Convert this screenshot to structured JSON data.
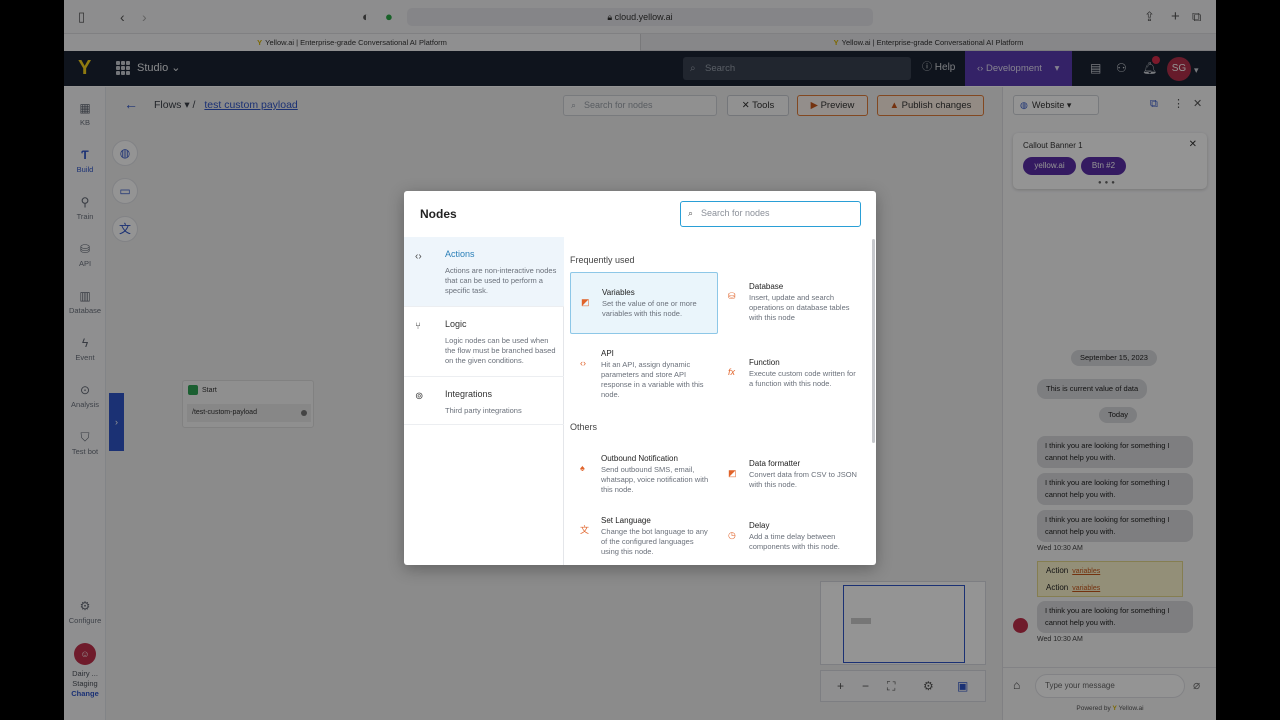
{
  "browser": {
    "url": "cloud.yellow.ai",
    "tabs": [
      {
        "title": "Yellow.ai | Enterprise-grade Conversational AI Platform"
      },
      {
        "title": "Yellow.ai | Enterprise-grade Conversational AI Platform"
      }
    ]
  },
  "header": {
    "app_name": "Studio",
    "search_placeholder": "Search",
    "help_label": "Help",
    "environment": "Development",
    "avatar_initials": "SG"
  },
  "rail": {
    "items": [
      {
        "label": "KB",
        "icon": "kb-icon"
      },
      {
        "label": "Build",
        "icon": "build-icon"
      },
      {
        "label": "Train",
        "icon": "train-icon"
      },
      {
        "label": "API",
        "icon": "api-icon"
      },
      {
        "label": "Database",
        "icon": "database-icon"
      },
      {
        "label": "Event",
        "icon": "event-icon"
      },
      {
        "label": "Analysis",
        "icon": "analysis-icon"
      },
      {
        "label": "Test bot",
        "icon": "test-bot-icon"
      }
    ],
    "configure_label": "Configure",
    "workspace_line1": "Dairy ...",
    "workspace_line2": "Staging",
    "change_label": "Change"
  },
  "canvas": {
    "breadcrumb_root": "Flows",
    "breadcrumb_current": "test custom payload",
    "search_placeholder": "Search for nodes",
    "tools_label": "Tools",
    "preview_label": "Preview",
    "publish_label": "Publish changes",
    "start_node": {
      "title": "Start",
      "path": "/test-custom-payload"
    }
  },
  "modal": {
    "title": "Nodes",
    "search_placeholder": "Search for nodes",
    "categories": [
      {
        "name": "Actions",
        "desc": "Actions are non-interactive nodes that can be used to perform a specific task.",
        "icon": "code-icon"
      },
      {
        "name": "Logic",
        "desc": "Logic nodes can be used when the flow must be branched based on the given conditions.",
        "icon": "branch-icon"
      },
      {
        "name": "Integrations",
        "desc": "Third party integrations",
        "icon": "link-icon"
      }
    ],
    "sections": {
      "frequent": "Frequently used",
      "others": "Others"
    },
    "nodes": [
      {
        "name": "Variables",
        "desc": "Set the value of one or more variables with this node.",
        "icon": "variables-icon"
      },
      {
        "name": "Database",
        "desc": "Insert, update and search operations on database tables with this node",
        "icon": "database-icon"
      },
      {
        "name": "API",
        "desc": "Hit an API, assign dynamic parameters and store API response in a variable with this node.",
        "icon": "api-icon"
      },
      {
        "name": "Function",
        "desc": "Execute custom code written for a function with this node.",
        "icon": "function-icon"
      },
      {
        "name": "Outbound Notification",
        "desc": "Send outbound SMS, email, whatsapp, voice notification with this node.",
        "icon": "bell-icon"
      },
      {
        "name": "Data formatter",
        "desc": "Convert data from CSV to JSON with this node.",
        "icon": "formatter-icon"
      },
      {
        "name": "Set Language",
        "desc": "Change the bot language to any of the configured languages using this node.",
        "icon": "translate-icon"
      },
      {
        "name": "Delay",
        "desc": "Add a time delay between components with this node.",
        "icon": "clock-icon"
      }
    ]
  },
  "preview": {
    "channel": "Website",
    "callout_title": "Callout Banner 1",
    "callout_btn1": "yellow.ai",
    "callout_btn2": "Btn #2",
    "date_chip": "September 15, 2023",
    "msg_value": "This is current value of data",
    "today_chip": "Today",
    "bot_msg": "I think you are looking for something I cannot help you with.",
    "timestamp": "Wed 10:30 AM",
    "action_label": "Action",
    "action_value": "variables",
    "composer_placeholder": "Type your message",
    "powered_by": "Powered by",
    "powered_brand": "Yellow.ai"
  },
  "colors": {
    "accent": "#2f55c9",
    "header_bg": "#1b2433",
    "env_bg": "#5a3bb1",
    "action_orange": "#e0632a",
    "brand_purple": "#5a2da8"
  }
}
